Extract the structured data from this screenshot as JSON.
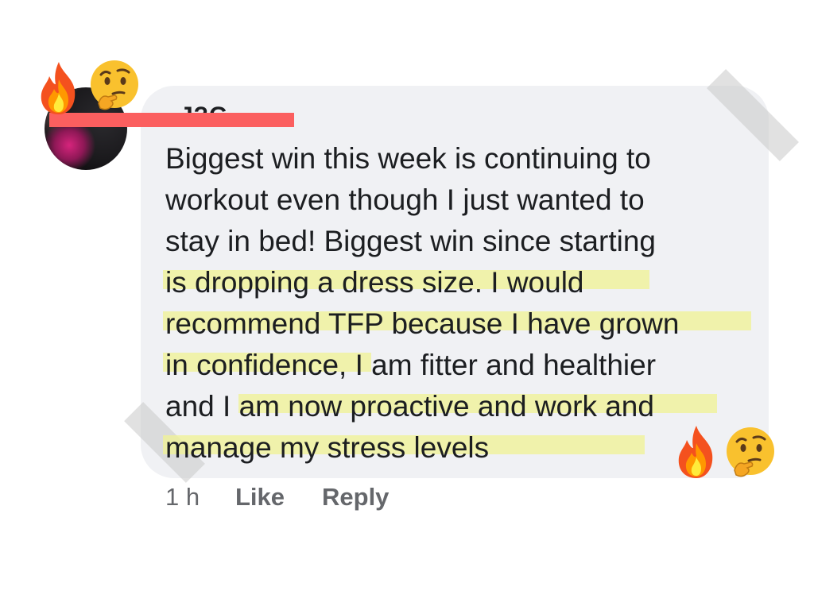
{
  "comment": {
    "author_partial": "J?G",
    "lines": [
      "Biggest win this week is continuing to",
      "workout even though I just wanted to",
      "stay in bed! Biggest win since starting",
      "is dropping a dress size. I would",
      "recommend TFP because I have grown",
      "in confidence, I am fitter and healthier",
      "and I am now proactive and work and",
      "manage my stress levels"
    ]
  },
  "actions": {
    "time": "1 h",
    "like": "Like",
    "reply": "Reply"
  },
  "decorations": {
    "emoji_top": [
      "fire-emoji",
      "thinking-face-emoji"
    ],
    "emoji_bottom": [
      "fire-emoji",
      "thinking-face-emoji"
    ]
  },
  "colors": {
    "bubble": "#f0f1f4",
    "text": "#1c1e21",
    "meta": "#65676b",
    "highlight": "#f0f296",
    "redaction": "#fb5f5f"
  }
}
